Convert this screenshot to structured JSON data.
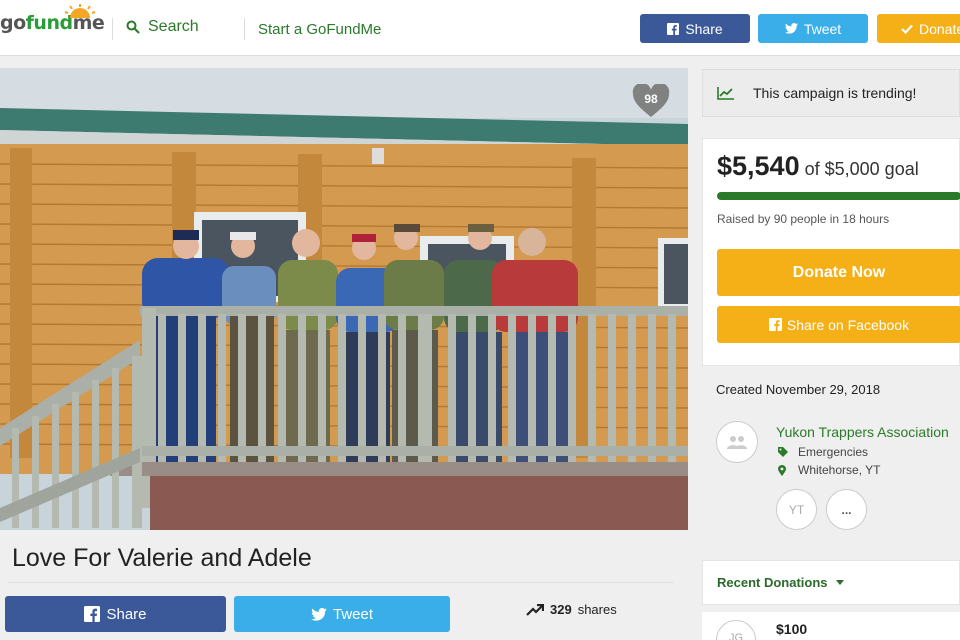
{
  "header": {
    "logo_go": "go",
    "logo_fund": "fund",
    "logo_me": "me",
    "search_label": "Search",
    "start_label": "Start a GoFundMe",
    "share_label": "Share",
    "tweet_label": "Tweet",
    "donate_label": "Donate"
  },
  "campaign": {
    "heart_count": "98",
    "title": "Love For Valerie and Adele",
    "share_label": "Share",
    "tweet_label": "Tweet",
    "shares_count": "329",
    "shares_suffix": "shares"
  },
  "sidebar": {
    "trending_text": "This campaign is trending!",
    "raised_amount": "$5,540",
    "goal_text": "of $5,000 goal",
    "raised_by": "Raised by 90 people in 18 hours",
    "progress_fraction": 1.0,
    "donate_now_label": "Donate Now",
    "share_fb_label": "Share on Facebook",
    "created": "Created November 29, 2018",
    "organizer_name": "Yukon Trappers Association",
    "category": "Emergencies",
    "location": "Whitehorse, YT",
    "yt_initials": "YT",
    "more_label": "...",
    "recent_donations_label": "Recent Donations",
    "donation_initials": "JG",
    "donation_amount": "$100"
  },
  "colors": {
    "facebook": "#3b5998",
    "twitter": "#3aaee8",
    "donate": "#f5b017",
    "brand_green": "#2a7a2a"
  },
  "icons": [
    "sun-logo-icon",
    "search-icon",
    "facebook-icon",
    "twitter-icon",
    "check-icon",
    "heart-icon",
    "trending-icon",
    "tag-icon",
    "location-pin-icon",
    "people-icon",
    "chevron-down-icon"
  ]
}
